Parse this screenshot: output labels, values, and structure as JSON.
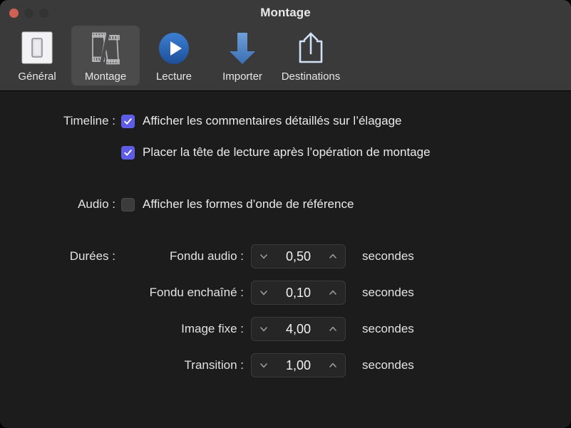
{
  "window": {
    "title": "Montage",
    "traffic_lights": [
      {
        "name": "close",
        "color": "#cf6056"
      },
      {
        "name": "minimize",
        "color": "#333333"
      },
      {
        "name": "zoom",
        "color": "#333333"
      }
    ]
  },
  "toolbar": {
    "items": [
      {
        "label": "Général",
        "icon": "light-switch-icon",
        "selected": false
      },
      {
        "label": "Montage",
        "icon": "film-strip-cut-icon",
        "selected": true
      },
      {
        "label": "Lecture",
        "icon": "play-circle-icon",
        "selected": false
      },
      {
        "label": "Importer",
        "icon": "arrow-down-icon",
        "selected": false
      },
      {
        "label": "Destinations",
        "icon": "share-export-icon",
        "selected": false
      }
    ]
  },
  "content": {
    "timeline": {
      "label": "Timeline :",
      "checkboxes": [
        {
          "label": "Afficher les commentaires détaillés sur l’élagage",
          "checked": true
        },
        {
          "label": "Placer la tête de lecture après l’opération de montage",
          "checked": true
        }
      ]
    },
    "audio": {
      "label": "Audio :",
      "checkboxes": [
        {
          "label": "Afficher les formes d’onde de référence",
          "checked": false
        }
      ]
    },
    "durations": {
      "label": "Durées :",
      "unit": "secondes",
      "fields": [
        {
          "label": "Fondu audio :",
          "value": "0,50"
        },
        {
          "label": "Fondu enchaîné :",
          "value": "0,10"
        },
        {
          "label": "Image fixe :",
          "value": "4,00"
        },
        {
          "label": "Transition :",
          "value": "1,00"
        }
      ]
    }
  },
  "colors": {
    "checkbox_on": "#5e5ce6",
    "toolbar_bg": "#3a3a3a",
    "content_bg": "#1c1c1c",
    "accent_blue": "#2a6bc4"
  }
}
